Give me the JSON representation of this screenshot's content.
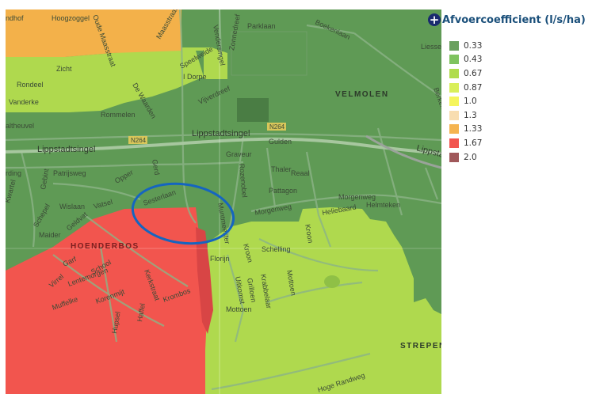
{
  "legend": {
    "title": "Afvoercoefficient (l/s/ha)",
    "toggle_icon": "plus-circle-icon",
    "items": [
      {
        "label": "0.33",
        "color": "#6aa05e"
      },
      {
        "label": "0.43",
        "color": "#7fc35f"
      },
      {
        "label": "0.67",
        "color": "#b0dc4c"
      },
      {
        "label": "0.87",
        "color": "#d9ef5a"
      },
      {
        "label": "1.0",
        "color": "#f5f55c"
      },
      {
        "label": "1.3",
        "color": "#f8ddb0"
      },
      {
        "label": "1.33",
        "color": "#f5b450"
      },
      {
        "label": "1.67",
        "color": "#f2554e"
      },
      {
        "label": "2.0",
        "color": "#a0585a"
      }
    ]
  },
  "map": {
    "colors": {
      "green_dark": "#5f9a55",
      "green_light": "#afd94e",
      "orange": "#f3b14a",
      "red": "#f2554e",
      "highlight_ellipse": "#1565c0"
    },
    "place_labels": {
      "velmolen": "VELMOLEN",
      "hoenderbos": "HOENDERBOS",
      "strepen": "STREPEN"
    },
    "road_labels": {
      "lippstadtsingel_w": "Lippstadtsingel",
      "lippstadtsingel_c": "Lippstadtsingel",
      "lippstadtsingel_e": "Lippsta",
      "n264_a": "N264",
      "n264_b": "N264",
      "hoogzoggel": "Hoogzoggel",
      "oude_maasstraat": "Oude Maasstraat",
      "maasstraat": "Maasstraat",
      "parklaan": "Parklaan",
      "boekenlaan": "Boekenlaan",
      "liessel": "Liessel",
      "rondeel": "Rondeel",
      "zicht": "Zicht",
      "vijverdreef": "Vijverdreef",
      "rommelen": "Rommelen",
      "gulden": "Gulden",
      "graveur": "Graveur",
      "patrijsweg": "Patrijsweg",
      "vatsel": "Vatsel",
      "wislaan": "Wislaan",
      "maider": "Maider",
      "morgenweg_a": "Morgenweg",
      "morgenweg_b": "Morgenweg",
      "helmteken": "Helmteken",
      "heliebaard": "Heliebaard",
      "schelling": "Schelling",
      "florijn": "Florijn",
      "mottoen_a": "Mottoen",
      "mottoen_b": "Mottoen",
      "krombos": "Krombos",
      "hogerandweg": "Hoge Randweg",
      "patagon": "Pattagon",
      "reaal": "Reaal",
      "thaler": "Thaler",
      "rozenobel": "Rozenobel",
      "munt": "Muntmeester",
      "sesterlaan": "Sesterlaan",
      "opper": "Opper",
      "gerd": "Gerd",
      "ording": "rding",
      "altheuvel": "altheuvel",
      "vanderke": "Vanderke",
      "dwaartelaan": "De Waarden",
      "ndhof": "ndhof",
      "speel": "Speelweide",
      "dorpe": "I Dorpe",
      "vendersingel": "Vendersingel",
      "zonnedreef": "Zonnedreef",
      "berkenlaan": "Berkenlaan",
      "kerkstraat": "Kerkstraat",
      "garf": "Garf",
      "school": "School",
      "virrel": "Virrel",
      "lentemorgen": "Lentemorgen",
      "korenmijt": "Korenmijt",
      "muffelke": "Muffelke",
      "hupsel": "Hupsel",
      "haffel": "Haffel",
      "kroon": "Kroon",
      "uitkomst": "Uitkomst",
      "grilloen": "Grilloen",
      "krabbelaar": "Krabbelaar",
      "geldvat": "Geldvat",
      "gebint": "Gebint",
      "schepel": "Schepel",
      "kwartel": "Kwartel"
    }
  }
}
